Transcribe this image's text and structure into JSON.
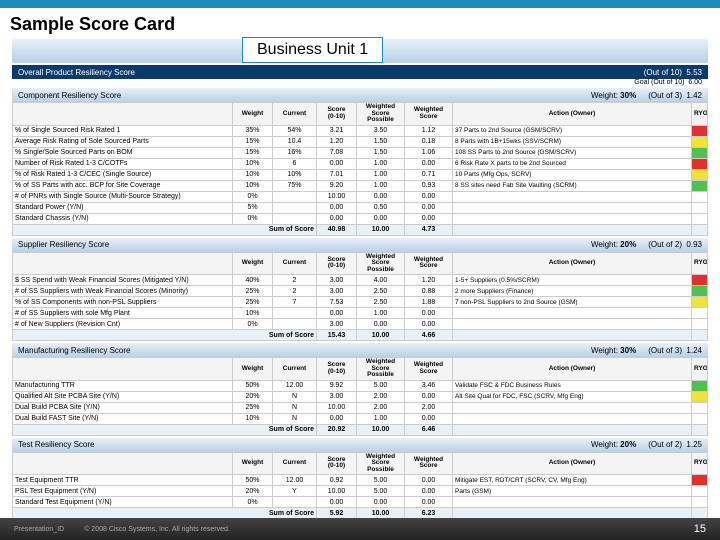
{
  "slide": {
    "title": "Sample Score Card",
    "bu_label": "Business Unit 1",
    "pres_id": "Presentation_ID",
    "copyright": "© 2008 Cisco Systems, Inc. All rights reserved.",
    "page": "15"
  },
  "overall": {
    "label": "Overall Product Resiliency Score",
    "out_of_label": "(Out of 10)",
    "out_of_val": "5.53",
    "goal_label": "Goal (Out of 10)",
    "goal_val": "6.00"
  },
  "cols": {
    "weight": "Weight",
    "current": "Current",
    "score": "Score\n(0-10)",
    "wpossible": "Weighted\nScore\nPossible",
    "wscore": "Weighted\nScore",
    "action": "Action (Owner)",
    "ryg": "RYG",
    "sum": "Sum of Score"
  },
  "sections": [
    {
      "name": "Component Resiliency Score",
      "weight": "30%",
      "out_of": "(Out of 3)",
      "val": "1.42",
      "rows": [
        {
          "n": "% of Single Sourced Risk Rated 1",
          "w": "35%",
          "c": "54%",
          "s": "3.21",
          "wp": "3.50",
          "ws": "1.12",
          "a": "37 Parts to 2nd Source (GSM/SCRV)",
          "r": "R"
        },
        {
          "n": "Average Risk Rating of Sole Sourced Parts",
          "w": "15%",
          "c": "10.4",
          "s": "1.20",
          "wp": "1.50",
          "ws": "0.18",
          "a": "8 Parts with 1B+15wks (SSV/SCRM)",
          "r": "Y"
        },
        {
          "n": "% Single/Sole Sourced Parts on BOM",
          "w": "15%",
          "c": "16%",
          "s": "7.08",
          "wp": "1.50",
          "ws": "1.06",
          "a": "108 SS Parts to 2nd Source (GSM/SCRV)",
          "r": "G"
        },
        {
          "n": "Number of Risk Rated 1-3 C/COTFs",
          "w": "10%",
          "c": "6",
          "s": "0.00",
          "wp": "1.00",
          "ws": "0.00",
          "a": "6 Risk Rate X parts to be 2nd Sourced",
          "r": "R"
        },
        {
          "n": "% of Risk Rated 1-3 C/CEC (Single Source)",
          "w": "10%",
          "c": "10%",
          "s": "7.01",
          "wp": "1.00",
          "ws": "0.71",
          "a": "10 Parts (Mfg Ops, SCRV)",
          "r": "Y"
        },
        {
          "n": "% of SS Parts with acc. BCP for Site Coverage",
          "w": "10%",
          "c": "75%",
          "s": "9.20",
          "wp": "1.00",
          "ws": "0.93",
          "a": "8 SS sites need Fab Site Vaulting (SCRM)",
          "r": "G"
        },
        {
          "n": "# of PNRs with Single Source (Multi-Source Strategy)",
          "w": "0%",
          "c": "",
          "s": "10.00",
          "wp": "0.00",
          "ws": "0.00",
          "a": "",
          "r": ""
        },
        {
          "n": "Standard Power (Y/N)",
          "w": "5%",
          "c": "",
          "s": "0.00",
          "wp": "0.50",
          "ws": "0.00",
          "a": "",
          "r": ""
        },
        {
          "n": "Standard Chassis (Y/N)",
          "w": "0%",
          "c": "",
          "s": "0.00",
          "wp": "0.00",
          "ws": "0.00",
          "a": "",
          "r": ""
        }
      ],
      "sum": {
        "s": "40.98",
        "wp": "10.00",
        "ws": "4.73"
      }
    },
    {
      "name": "Supplier Resiliency Score",
      "weight": "20%",
      "out_of": "(Out of 2)",
      "val": "0.93",
      "rows": [
        {
          "n": "$ SS Spend with Weak Financial Scores (Mitigated Y/N)",
          "w": "40%",
          "c": "2",
          "s": "3.00",
          "wp": "4.00",
          "ws": "1.20",
          "a": "1-5+ Suppliers (0.5%/SCRM)",
          "r": "R"
        },
        {
          "n": "# of SS Suppliers with Weak Financial Scores (Minority)",
          "w": "25%",
          "c": "2",
          "s": "3.00",
          "wp": "2.50",
          "ws": "0.88",
          "a": "2 more Suppliers (Finance)",
          "r": "G"
        },
        {
          "n": "% of SS Components with non-PSL Suppliers",
          "w": "25%",
          "c": "7",
          "s": "7.53",
          "wp": "2.50",
          "ws": "1.88",
          "a": "7 non-PSL Suppliers to 2nd Source (GSM)",
          "r": "Y"
        },
        {
          "n": "# of SS Suppliers with sole Mfg Plant",
          "w": "10%",
          "c": "",
          "s": "0.00",
          "wp": "1.00",
          "ws": "0.00",
          "a": "",
          "r": ""
        },
        {
          "n": "# of New Suppliers (Revision Cnt)",
          "w": "0%",
          "c": "",
          "s": "3.00",
          "wp": "0.00",
          "ws": "0.00",
          "a": "",
          "r": ""
        }
      ],
      "sum": {
        "s": "15.43",
        "wp": "10.00",
        "ws": "4.66"
      }
    },
    {
      "name": "Manufacturing Resiliency Score",
      "weight": "30%",
      "out_of": "(Out of 3)",
      "val": "1.24",
      "rows": [
        {
          "n": "Manufacturing TTR",
          "w": "50%",
          "c": "12.00",
          "s": "9.92",
          "wp": "5.00",
          "ws": "3.46",
          "a": "Validate FSC & FDC Business Rules",
          "r": "G"
        },
        {
          "n": "Qualified Alt Site PCBA Site (Y/N)",
          "w": "20%",
          "c": "N",
          "s": "3.00",
          "wp": "2.00",
          "ws": "0.00",
          "a": "Alt Site Qual for FDC, FSC (SCRV, Mfg Eng)",
          "r": "Y"
        },
        {
          "n": "Dual Build PCBA Site (Y/N)",
          "w": "25%",
          "c": "N",
          "s": "10.00",
          "wp": "2.00",
          "ws": "2.00",
          "a": "",
          "r": ""
        },
        {
          "n": "Dual Build FAST Site (Y/N)",
          "w": "10%",
          "c": "N",
          "s": "0.00",
          "wp": "1.00",
          "ws": "0.00",
          "a": "",
          "r": ""
        }
      ],
      "sum": {
        "s": "20.92",
        "wp": "10.00",
        "ws": "6.46"
      }
    },
    {
      "name": "Test Resiliency Score",
      "weight": "20%",
      "out_of": "(Out of 2)",
      "val": "1.25",
      "rows": [
        {
          "n": "Test Equipment TTR",
          "w": "50%",
          "c": "12.00",
          "s": "0.92",
          "wp": "5.00",
          "ws": "0.00",
          "a": "Mitigate EST, RDT/CRT (SCRV, CV, Mfg Eng)",
          "r": "R"
        },
        {
          "n": "PSL Test Equipment (Y/N)",
          "w": "20%",
          "c": "Y",
          "s": "10.00",
          "wp": "5.00",
          "ws": "0.00",
          "a": "Parts (GSM)",
          "r": ""
        },
        {
          "n": "Standard Test Equipment (Y/N)",
          "w": "0%",
          "c": "",
          "s": "0.00",
          "wp": "0.00",
          "ws": "0.00",
          "a": "",
          "r": ""
        }
      ],
      "sum": {
        "s": "5.92",
        "wp": "10.00",
        "ws": "6.23"
      }
    }
  ]
}
